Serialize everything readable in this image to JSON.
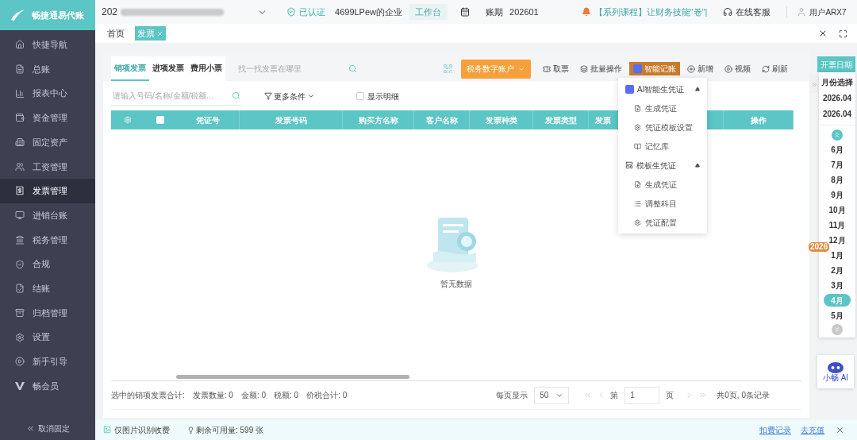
{
  "app": {
    "logo_text": "畅捷通易代账"
  },
  "topbar": {
    "company_prefix": "202",
    "verified": "已认证",
    "company": "4699LPew的企业",
    "workbench": "工作台",
    "period_label": "账期",
    "period": "202601",
    "notice": "【系列课程】让财务技能\"卷\"|",
    "support": "在线客服",
    "user": "用户ARX7"
  },
  "sidebar": {
    "items": [
      {
        "label": "快捷导航",
        "selected": false
      },
      {
        "label": "总账",
        "selected": false
      },
      {
        "label": "报表中心",
        "selected": false
      },
      {
        "label": "资金管理",
        "selected": false
      },
      {
        "label": "固定资产",
        "selected": false
      },
      {
        "label": "工资管理",
        "selected": false
      },
      {
        "label": "发票管理",
        "selected": true
      },
      {
        "label": "进销台账",
        "selected": false
      },
      {
        "label": "税务管理",
        "selected": false
      },
      {
        "label": "合规",
        "selected": false
      },
      {
        "label": "结账",
        "selected": false
      },
      {
        "label": "归档管理",
        "selected": false
      },
      {
        "label": "设置",
        "selected": false
      },
      {
        "label": "新手引导",
        "selected": false
      },
      {
        "label": "畅会员",
        "selected": false
      }
    ],
    "unpin": "取消固定"
  },
  "page_tabs": [
    {
      "label": "首页",
      "selected": false,
      "closable": false
    },
    {
      "label": "发票",
      "selected": true,
      "closable": true
    }
  ],
  "invoice_tabs": [
    {
      "label": "销项发票",
      "selected": true
    },
    {
      "label": "进项发票",
      "selected": false
    },
    {
      "label": "费用小票",
      "selected": false
    }
  ],
  "tab_search": {
    "placeholder": "找一找发票在哪里"
  },
  "toolbar": {
    "account_button": "税务数字账户",
    "actions": [
      {
        "label": "取票",
        "active": false
      },
      {
        "label": "批量操作",
        "active": false
      },
      {
        "label": "智能记账",
        "active": true
      },
      {
        "label": "新增",
        "active": false
      },
      {
        "label": "视频",
        "active": false
      },
      {
        "label": "刷新",
        "active": false
      }
    ]
  },
  "filter": {
    "placeholder": "请输入号码/名称/金额/税额...",
    "more": "更多条件",
    "show_detail": {
      "label": "显示明细",
      "checked": false
    }
  },
  "table": {
    "select_all_checked": false,
    "columns": [
      "凭证号",
      "发票号码",
      "购买方名称",
      "客户名称",
      "发票种类",
      "发票类型",
      "发票",
      "操作"
    ],
    "empty_text": "暂无数据"
  },
  "dropdown": {
    "groups": [
      {
        "label": "AI智能生凭证",
        "expanded": true,
        "items": [
          "生成凭证",
          "凭证模板设置",
          "记忆库"
        ]
      },
      {
        "label": "模板生凭证",
        "expanded": true,
        "items": [
          "生成凭证",
          "调整科目",
          "凭证配置"
        ]
      }
    ]
  },
  "footer": {
    "summary_title": "选中的销项发票合计:",
    "summary": [
      {
        "label": "发票数量:",
        "value": "0"
      },
      {
        "label": "金额:",
        "value": "0"
      },
      {
        "label": "税额:",
        "value": "0"
      },
      {
        "label": "价税合计:",
        "value": "0"
      }
    ],
    "page_size_label": "每页显示",
    "page_size": "50",
    "page_prefix": "第",
    "page": "1",
    "page_suffix": "页",
    "total": "共0页, 0条记录"
  },
  "banner": {
    "notice": "仅图片识别收费",
    "remaining": "剩余可用量: 599 张",
    "links": [
      "扣费记录",
      "去充值"
    ]
  },
  "calendar": {
    "tab": "开票日期",
    "title": "月份选择",
    "range": [
      "2026.04",
      "2026.04"
    ],
    "months": [
      {
        "label": "6月",
        "selected": false
      },
      {
        "label": "7月",
        "selected": false
      },
      {
        "label": "8月",
        "selected": false
      },
      {
        "label": "9月",
        "selected": false
      },
      {
        "label": "10月",
        "selected": false
      },
      {
        "label": "11月",
        "selected": false
      },
      {
        "label": "12月",
        "selected": false
      },
      {
        "label": "1月",
        "selected": false,
        "year": "2026"
      },
      {
        "label": "2月",
        "selected": false
      },
      {
        "label": "3月",
        "selected": false
      },
      {
        "label": "4月",
        "selected": true
      },
      {
        "label": "5月",
        "selected": false
      }
    ]
  },
  "assistant": {
    "label": "小畅 AI"
  }
}
